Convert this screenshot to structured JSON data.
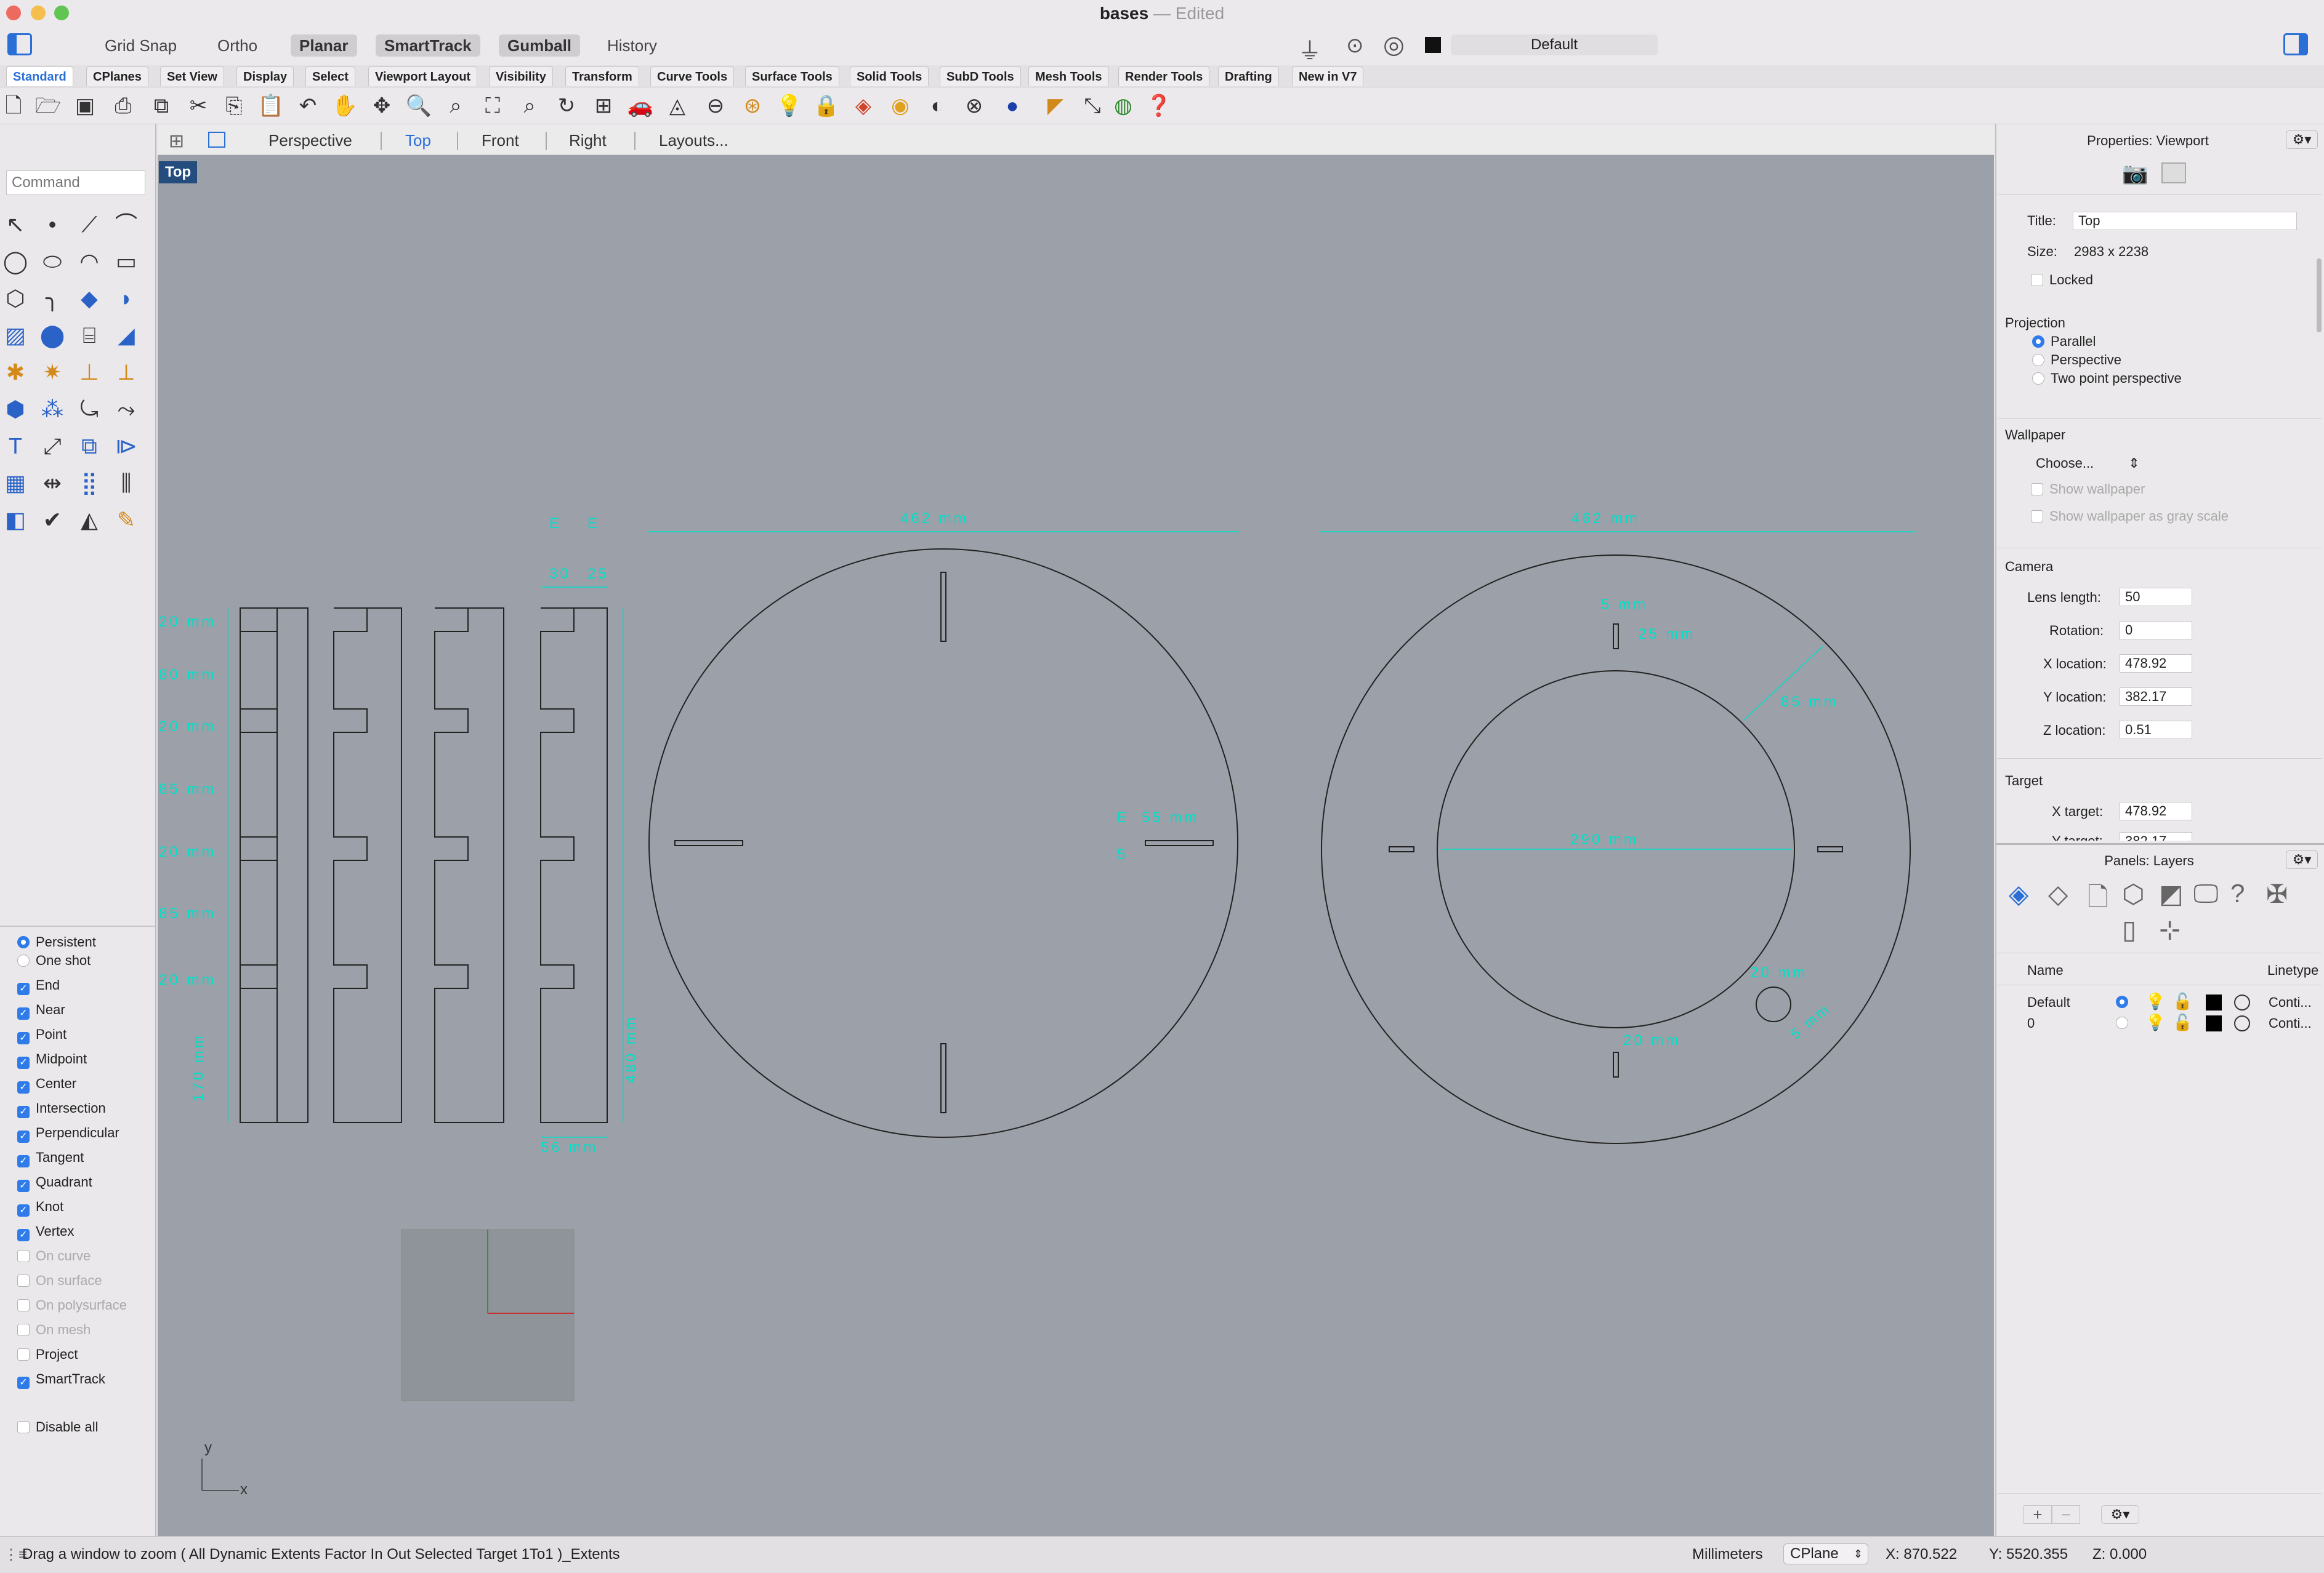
{
  "window": {
    "title": "bases",
    "edited": "— Edited"
  },
  "modes": [
    "Grid Snap",
    "Ortho",
    "Planar",
    "SmartTrack",
    "Gumball",
    "History"
  ],
  "modes_on": [
    false,
    false,
    true,
    true,
    true,
    false
  ],
  "layer_selector": "Default",
  "tabs": [
    "Standard",
    "CPlanes",
    "Set View",
    "Display",
    "Select",
    "Viewport Layout",
    "Visibility",
    "Transform",
    "Curve Tools",
    "Surface Tools",
    "Solid Tools",
    "SubD Tools",
    "Mesh Tools",
    "Render Tools",
    "Drafting",
    "New in V7"
  ],
  "toolbar_icons": [
    "new-file",
    "open-file",
    "save",
    "print",
    "import",
    "cut",
    "copy",
    "paste",
    "undo",
    "pan",
    "rotate-view",
    "zoom",
    "zoom-window",
    "zoom-extents",
    "zoom-selected",
    "rotate",
    "grid",
    "car",
    "spotlight",
    "snapshot",
    "layer-swatch",
    "light",
    "gear",
    "materials",
    "color-wheel",
    "sphere",
    "render-mesh",
    "help",
    "blue-sphere",
    "tag",
    "arrow-tool",
    "globe",
    "question"
  ],
  "command": {
    "placeholder": "Command"
  },
  "viewport_tabs": [
    "Perspective",
    "Top",
    "Front",
    "Right",
    "Layouts..."
  ],
  "active_view": "Top",
  "osnap": {
    "mode_persistent": "Persistent",
    "mode_oneshot": "One shot",
    "items": [
      {
        "label": "End",
        "checked": true,
        "enabled": true
      },
      {
        "label": "Near",
        "checked": true,
        "enabled": true
      },
      {
        "label": "Point",
        "checked": true,
        "enabled": true
      },
      {
        "label": "Midpoint",
        "checked": true,
        "enabled": true
      },
      {
        "label": "Center",
        "checked": true,
        "enabled": true
      },
      {
        "label": "Intersection",
        "checked": true,
        "enabled": true
      },
      {
        "label": "Perpendicular",
        "checked": true,
        "enabled": true
      },
      {
        "label": "Tangent",
        "checked": true,
        "enabled": true
      },
      {
        "label": "Quadrant",
        "checked": true,
        "enabled": true
      },
      {
        "label": "Knot",
        "checked": true,
        "enabled": true
      },
      {
        "label": "Vertex",
        "checked": true,
        "enabled": true
      },
      {
        "label": "On curve",
        "checked": false,
        "enabled": false
      },
      {
        "label": "On surface",
        "checked": false,
        "enabled": false
      },
      {
        "label": "On polysurface",
        "checked": false,
        "enabled": false
      },
      {
        "label": "On mesh",
        "checked": false,
        "enabled": false
      },
      {
        "label": "Project",
        "checked": false,
        "enabled": true
      },
      {
        "label": "SmartTrack",
        "checked": true,
        "enabled": true
      }
    ],
    "disable_all": "Disable all"
  },
  "dims": {
    "top_left": "462 mm",
    "top_right": "462 mm",
    "e1": "E",
    "e2": "E",
    "v30": "30",
    "v25": "25",
    "left": [
      "20 mm",
      "80 mm",
      "20 mm",
      "85 mm",
      "20 mm",
      "85 mm",
      "20 mm"
    ],
    "left_bottom_v": "170 mm",
    "right_v": "480 mm",
    "bottom": "56 mm",
    "circle1_55": "55 mm",
    "circle1_e": "E",
    "circle1_5": "5",
    "circle2_5": "5 mm",
    "circle2_25": "25 mm",
    "circle2_85": "85 mm",
    "circle2_290": "290 mm",
    "circle2_20a": "20 mm",
    "circle2_20b": "20 mm",
    "circle2_diag": "5 mm"
  },
  "axis": {
    "y": "y",
    "x": "x"
  },
  "properties": {
    "header": "Properties: Viewport",
    "title_label": "Title:",
    "title_value": "Top",
    "size_label": "Size:",
    "size_value": "2983 x 2238",
    "locked": "Locked",
    "projection": "Projection",
    "proj_options": [
      "Parallel",
      "Perspective",
      "Two point perspective"
    ],
    "wallpaper": "Wallpaper",
    "choose": "Choose...",
    "show_wallpaper": "Show wallpaper",
    "show_gray": "Show wallpaper as gray scale",
    "camera": "Camera",
    "lens_label": "Lens length:",
    "lens_value": "50",
    "rotation_label": "Rotation:",
    "rotation_value": "0",
    "xloc_label": "X location:",
    "xloc_value": "478.92",
    "yloc_label": "Y location:",
    "yloc_value": "382.17",
    "zloc_label": "Z location:",
    "zloc_value": "0.51",
    "target": "Target",
    "xt_label": "X target:",
    "xt_value": "478.92",
    "yt_label": "Y target:",
    "yt_value": "382.17"
  },
  "layers": {
    "header": "Panels: Layers",
    "col_name": "Name",
    "col_linetype": "Linetype",
    "rows": [
      {
        "name": "Default",
        "linetype": "Conti..."
      },
      {
        "name": "0",
        "linetype": "Conti..."
      }
    ]
  },
  "status": {
    "message": "Drag a window to zoom ( All Dynamic Extents Factor In Out Selected Target 1To1 )_Extents",
    "units": "Millimeters",
    "cplane": "CPlane",
    "x": "X: 870.522",
    "y": "Y: 5520.355",
    "z": "Z: 0.000"
  }
}
